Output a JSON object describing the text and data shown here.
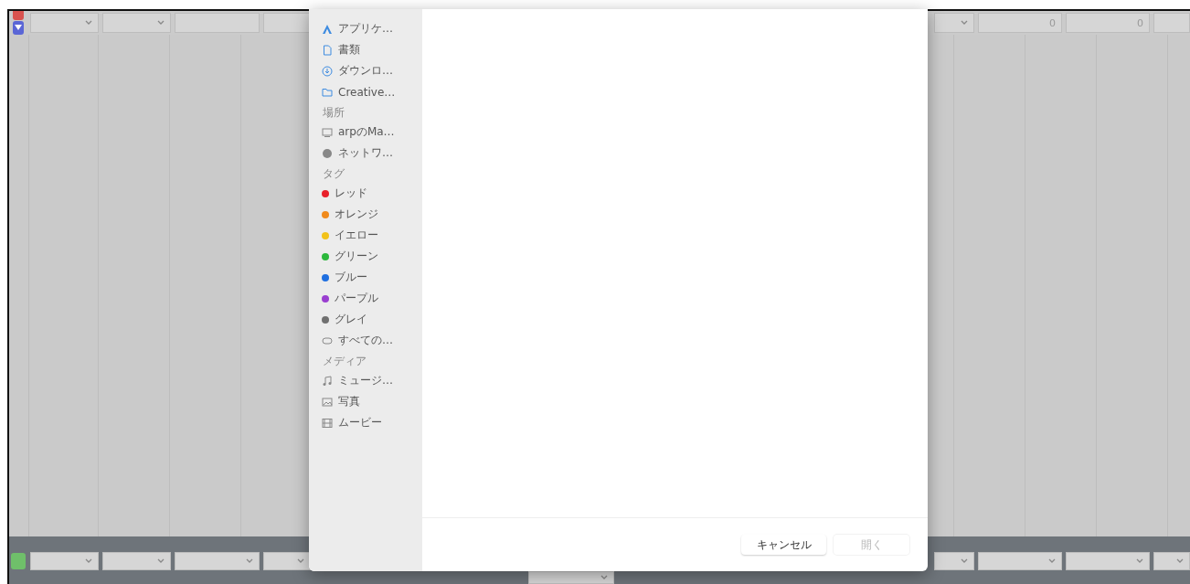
{
  "background_app": {
    "top_row": {
      "left": [
        {
          "kind": "dropdown"
        },
        {
          "kind": "dropdown"
        },
        {
          "kind": "field"
        },
        {
          "kind": "field"
        }
      ],
      "right": [
        {
          "kind": "dropdown"
        },
        {
          "kind": "field",
          "value": "0"
        },
        {
          "kind": "field",
          "value": "0"
        },
        {
          "kind": "field"
        }
      ]
    },
    "bottom_row": {
      "left": [
        {
          "kind": "dropdown"
        },
        {
          "kind": "dropdown"
        },
        {
          "kind": "dropdown"
        },
        {
          "kind": "dropdown"
        }
      ],
      "right": [
        {
          "kind": "dropdown"
        },
        {
          "kind": "dropdown"
        },
        {
          "kind": "dropdown"
        },
        {
          "kind": "dropdown"
        }
      ]
    }
  },
  "dialog": {
    "sidebar": [
      {
        "items": [
          {
            "kind": "apps",
            "label": "アプリケ…"
          },
          {
            "kind": "document",
            "label": "書類"
          },
          {
            "kind": "download",
            "label": "ダウンロ…"
          },
          {
            "kind": "folder",
            "label": "Creative…"
          }
        ]
      },
      {
        "header": "場所",
        "items": [
          {
            "kind": "computer",
            "label": "arpのMa…"
          },
          {
            "kind": "network",
            "label": "ネットワ…"
          }
        ]
      },
      {
        "header": "タグ",
        "items": [
          {
            "kind": "tag",
            "label": "レッド",
            "color": "#e8202a"
          },
          {
            "kind": "tag",
            "label": "オレンジ",
            "color": "#f08a1c"
          },
          {
            "kind": "tag",
            "label": "イエロー",
            "color": "#f2c21a"
          },
          {
            "kind": "tag",
            "label": "グリーン",
            "color": "#2cb83c"
          },
          {
            "kind": "tag",
            "label": "ブルー",
            "color": "#1f6fe0"
          },
          {
            "kind": "tag",
            "label": "パープル",
            "color": "#9a3fd0"
          },
          {
            "kind": "tag",
            "label": "グレイ",
            "color": "#707070"
          },
          {
            "kind": "all-tags",
            "label": "すべての…"
          }
        ]
      },
      {
        "header": "メディア",
        "items": [
          {
            "kind": "music",
            "label": "ミュージ…"
          },
          {
            "kind": "photo",
            "label": "写真"
          },
          {
            "kind": "movie",
            "label": "ムービー"
          }
        ]
      }
    ],
    "buttons": [
      {
        "label": "キャンセル",
        "disabled": false
      },
      {
        "label": "開く",
        "disabled": true
      }
    ]
  }
}
